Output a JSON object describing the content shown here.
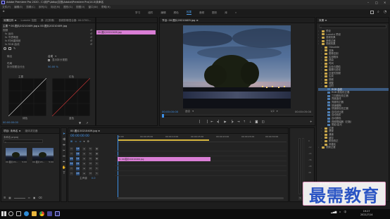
{
  "window": {
    "title": "Adobe Premiere Pro 2020 - C:\\用户\\Adbp\\文档\\Adobe\\Premiere Pro\\14.0\\未命名",
    "controls": [
      "–",
      "□",
      "×"
    ]
  },
  "menu": [
    "文件(F)",
    "编辑(E)",
    "剪辑(C)",
    "序列(S)",
    "标记(M)",
    "图形(G)",
    "视图(V)",
    "窗口(W)",
    "帮助(H)"
  ],
  "workspaces": [
    "学习",
    "组件",
    "编辑",
    "颜色",
    "效果",
    "音频",
    "图形",
    "库"
  ],
  "active_workspace": "效果",
  "effect_controls": {
    "tabs": [
      "效果控件 ≡",
      "Lumetri 范围",
      "源: (无剪辑)",
      "音频剪辑混合器: 00:0700..."
    ],
    "source_line": "主要 * 00.图片20210409.jpg ▸ 00.图片20210409.jpg",
    "clip_label": "00.图片20210409.jpg",
    "rows": [
      "视频",
      "fx 运动",
      "fx 不透明度",
      "fx 时间重映射",
      "fx RGB 曲线"
    ],
    "output_label": "输出",
    "output_value": "合成",
    "show_split": "显示拆分视图",
    "layout_label": "布局",
    "split_pct_label": "拆分视图百分比",
    "split_pct_value": "50.00 %",
    "curve_labels": [
      "主要",
      "红色",
      "绿色",
      "蓝色"
    ],
    "timecode": "00:00:00:00"
  },
  "program_monitor": {
    "tab": "节目: 00.图片20210409.jpg ≡",
    "timecode_left": "00:00:00:00",
    "fit_label": "适合",
    "fraction": "1/2",
    "timecode_right": "00:00:05:00",
    "timecode_right2": "00:00:05:00"
  },
  "project": {
    "tabs": [
      "项目: 未命名 ≡",
      "媒体浏览器"
    ],
    "path": "未命名.prproj",
    "search_placeholder": "",
    "items": [
      {
        "name": "00.图片20...",
        "duration": "5:00"
      },
      {
        "name": "00.图片20...",
        "duration": "5:00"
      }
    ]
  },
  "timeline": {
    "tab": "00.图片20210409.jpg ≡",
    "timecode": "00:00:00:00",
    "ruler": [
      "00:00",
      "00:00:05:00",
      "00:00:10:00",
      "00:00:15:00",
      "00:00:20:00",
      "00:00:25:00",
      "00:00:30:00"
    ],
    "tracks": [
      {
        "id": "V3"
      },
      {
        "id": "V2"
      },
      {
        "id": "V1"
      },
      {
        "id": "A1"
      },
      {
        "id": "A2"
      },
      {
        "id": "A3"
      }
    ],
    "master_label": "主声道",
    "master_value": "0.0",
    "clip_label": "fx 00.图片20210409.jpg"
  },
  "effects": {
    "tab": "效果 ≡",
    "items": [
      {
        "label": "预设",
        "level": 0,
        "kind": "folder"
      },
      {
        "label": "Lumetri 预设",
        "level": 0,
        "kind": "folder"
      },
      {
        "label": "音频效果",
        "level": 0,
        "kind": "folder"
      },
      {
        "label": "音频过渡",
        "level": 0,
        "kind": "folder"
      },
      {
        "label": "视频效果",
        "level": 0,
        "kind": "folder"
      },
      {
        "label": "Obsolete",
        "level": 1,
        "kind": "folder"
      },
      {
        "label": "变换",
        "level": 1,
        "kind": "folder"
      },
      {
        "label": "图像控制",
        "level": 1,
        "kind": "folder"
      },
      {
        "label": "实用程序",
        "level": 1,
        "kind": "folder"
      },
      {
        "label": "扭曲",
        "level": 1,
        "kind": "folder"
      },
      {
        "label": "时间",
        "level": 1,
        "kind": "folder"
      },
      {
        "label": "杂色与颗粒",
        "level": 1,
        "kind": "folder"
      },
      {
        "label": "模糊与锐化",
        "level": 1,
        "kind": "folder"
      },
      {
        "label": "沉浸式视频",
        "level": 1,
        "kind": "folder"
      },
      {
        "label": "生成",
        "level": 1,
        "kind": "folder"
      },
      {
        "label": "视频",
        "level": 1,
        "kind": "folder"
      },
      {
        "label": "调整",
        "level": 1,
        "kind": "folder"
      },
      {
        "label": "过时",
        "level": 1,
        "kind": "folder"
      },
      {
        "label": "RGB 曲线",
        "level": 2,
        "kind": "fx",
        "selected": true
      },
      {
        "label": "RGB 颜色校正器",
        "level": 2,
        "kind": "fx"
      },
      {
        "label": "三向颜色校正器",
        "level": 2,
        "kind": "fx"
      },
      {
        "label": "亮度曲线",
        "level": 2,
        "kind": "fx"
      },
      {
        "label": "亮度校正器",
        "level": 2,
        "kind": "fx"
      },
      {
        "label": "快速模糊",
        "level": 2,
        "kind": "fx"
      },
      {
        "label": "快速颜色校正器",
        "level": 2,
        "kind": "fx"
      },
      {
        "label": "自动对比度",
        "level": 2,
        "kind": "fx"
      },
      {
        "label": "自动色阶",
        "level": 2,
        "kind": "fx"
      },
      {
        "label": "自动颜色",
        "level": 2,
        "kind": "fx"
      },
      {
        "label": "视频限幅器（旧版）",
        "level": 2,
        "kind": "fx"
      },
      {
        "label": "阴影/高光",
        "level": 2,
        "kind": "fx"
      },
      {
        "label": "过渡",
        "level": 1,
        "kind": "folder"
      },
      {
        "label": "透视",
        "level": 1,
        "kind": "folder"
      },
      {
        "label": "通道",
        "level": 1,
        "kind": "folder"
      },
      {
        "label": "键控",
        "level": 1,
        "kind": "folder"
      },
      {
        "label": "颜色校正",
        "level": 1,
        "kind": "folder"
      },
      {
        "label": "风格化",
        "level": 1,
        "kind": "folder"
      },
      {
        "label": "视频过渡",
        "level": 0,
        "kind": "folder"
      }
    ],
    "bottom_tab": "基本图形"
  },
  "taskbar": {
    "time": "19:27",
    "date": "2021/7/14",
    "lang": "中"
  },
  "watermark": "最需教育",
  "colors": {
    "accent_blue": "#2d8ceb",
    "clip_pink": "#d97ed5",
    "selected_row": "#3b5a80"
  }
}
